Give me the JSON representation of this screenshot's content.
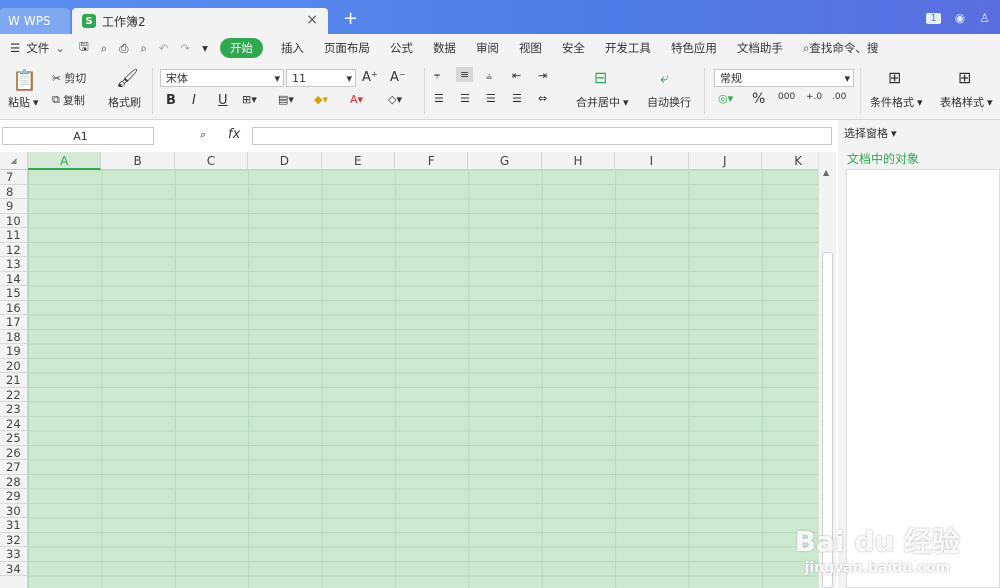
{
  "titlebar": {
    "wps_tab": "WPS",
    "doc_tab": "工作簿2",
    "doc_icon": "S",
    "badge": "1"
  },
  "menu": {
    "file": "文件",
    "start": "开始",
    "items": [
      "插入",
      "页面布局",
      "公式",
      "数据",
      "审阅",
      "视图",
      "安全",
      "开发工具",
      "特色应用",
      "文档助手"
    ],
    "search": "查找命令、搜"
  },
  "ribbon": {
    "paste": "粘贴",
    "cut": "剪切",
    "copy": "复制",
    "format_painter": "格式刷",
    "font": "宋体",
    "size": "11",
    "bold": "B",
    "italic": "I",
    "underline": "U",
    "merge": "合并居中",
    "wrap": "自动换行",
    "number_format": "常规",
    "percent": "%",
    "thousands": "000",
    "cond_format": "条件格式",
    "table_style": "表格样式"
  },
  "formula": {
    "cell_ref": "A1",
    "fx": "fx"
  },
  "sheet": {
    "columns": [
      "A",
      "B",
      "C",
      "D",
      "E",
      "F",
      "G",
      "H",
      "I",
      "J",
      "K"
    ],
    "rows": [
      "7",
      "8",
      "9",
      "10",
      "11",
      "12",
      "13",
      "14",
      "15",
      "16",
      "17",
      "18",
      "19",
      "20",
      "21",
      "22",
      "23",
      "24",
      "25",
      "26",
      "27",
      "28",
      "29",
      "30",
      "31",
      "32",
      "33",
      "34"
    ]
  },
  "pane": {
    "title": "选择窗格",
    "subtitle": "文档中的对象"
  },
  "watermark": {
    "line1": "Bai du 经验",
    "line2": "jingyan.baidu.com"
  }
}
